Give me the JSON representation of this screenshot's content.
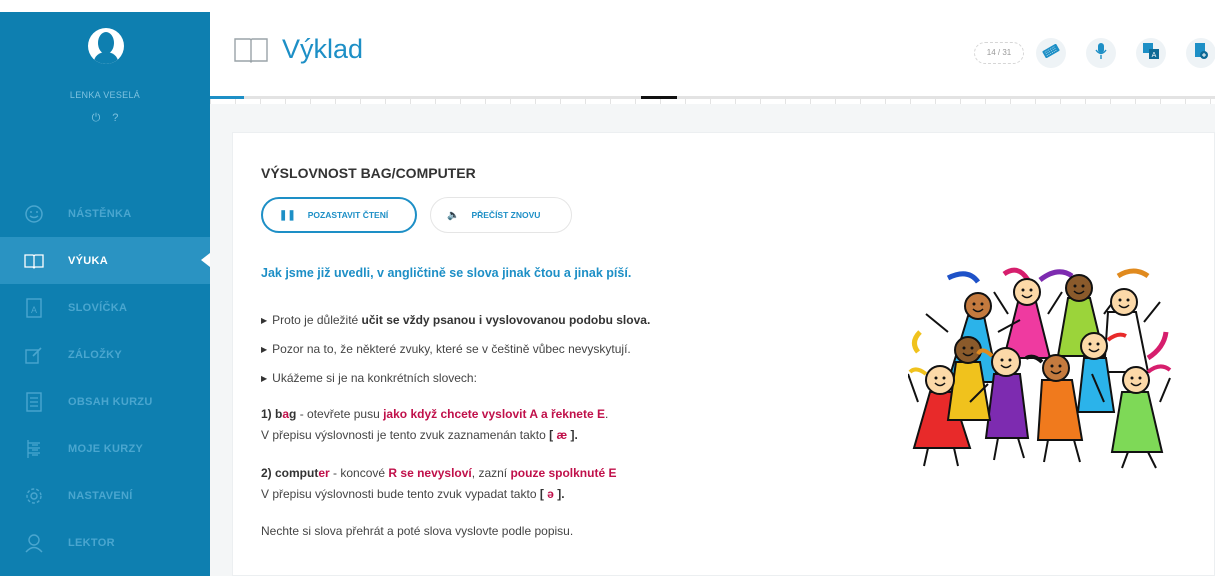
{
  "user": {
    "name": "LENKA VESELÁ",
    "logout_icon": "power-icon",
    "help_icon": "help-icon"
  },
  "sidebar": {
    "items": [
      {
        "label": "NÁSTĚNKA",
        "icon": "smiley-icon",
        "active": false
      },
      {
        "label": "VÝUKA",
        "icon": "book-icon",
        "active": true
      },
      {
        "label": "SLOVÍČKA",
        "icon": "vocabulary-icon",
        "active": false
      },
      {
        "label": "ZÁLOŽKY",
        "icon": "bookmark-edit-icon",
        "active": false
      },
      {
        "label": "OBSAH KURZU",
        "icon": "contents-icon",
        "active": false
      },
      {
        "label": "MOJE KURZY",
        "icon": "courses-icon",
        "active": false
      },
      {
        "label": "NASTAVENÍ",
        "icon": "gear-icon",
        "active": false
      },
      {
        "label": "LEKTOR",
        "icon": "tutor-icon",
        "active": false
      }
    ]
  },
  "header": {
    "title": "Výklad",
    "counter": "14 / 31",
    "buttons": [
      "keyboard-icon",
      "microphone-icon",
      "translate-icon",
      "notes-icon"
    ],
    "progress_fraction": 0.034,
    "accent": "#1d8fc6"
  },
  "lesson": {
    "title": "VÝSLOVNOST BAG/COMPUTER",
    "pause_label": "POZASTAVIT ČTENÍ",
    "replay_label": "PŘEČÍST ZNOVU",
    "intro": "Jak jsme již uvedli, v angličtině se slova jinak čtou a jinak píší.",
    "bullet1_pre": "Proto je důležité ",
    "bullet1_bold": "učit se vždy psanou i vyslovovanou podobu slova.",
    "bullet2": "Pozor na to, že některé zvuky, které se v češtině vůbec nevyskytují.",
    "bullet3": "Ukážeme si je na konkrétních slovech:",
    "ex1_num": "1) b",
    "ex1_highlight": "a",
    "ex1_rest": "g",
    "ex1_mid": " - otevřete pusu ",
    "ex1_red": "jako když chcete vyslovit A a řeknete E",
    "ex1_end": ".",
    "ex1_line2_pre": "V přepisu výslovnosti je tento zvuk zaznamenán takto ",
    "ex1_symbol_open": "[ ",
    "ex1_symbol": "æ",
    "ex1_symbol_close": " ].",
    "ex2_num": "2) comput",
    "ex2_highlight": "er",
    "ex2_mid": " - koncové ",
    "ex2_red1": "R se nevysloví",
    "ex2_mid2": ", zazní ",
    "ex2_red2": "pouze spolknuté E",
    "ex2_line2_pre": "V přepisu výslovnosti bude tento zvuk vypadat takto ",
    "ex2_symbol_open": "[ ",
    "ex2_symbol": "ə",
    "ex2_symbol_close": " ].",
    "outro": "Nechte si slova přehrát a poté slova vyslovte podle popisu.",
    "highlight_color": "#c0104a"
  }
}
